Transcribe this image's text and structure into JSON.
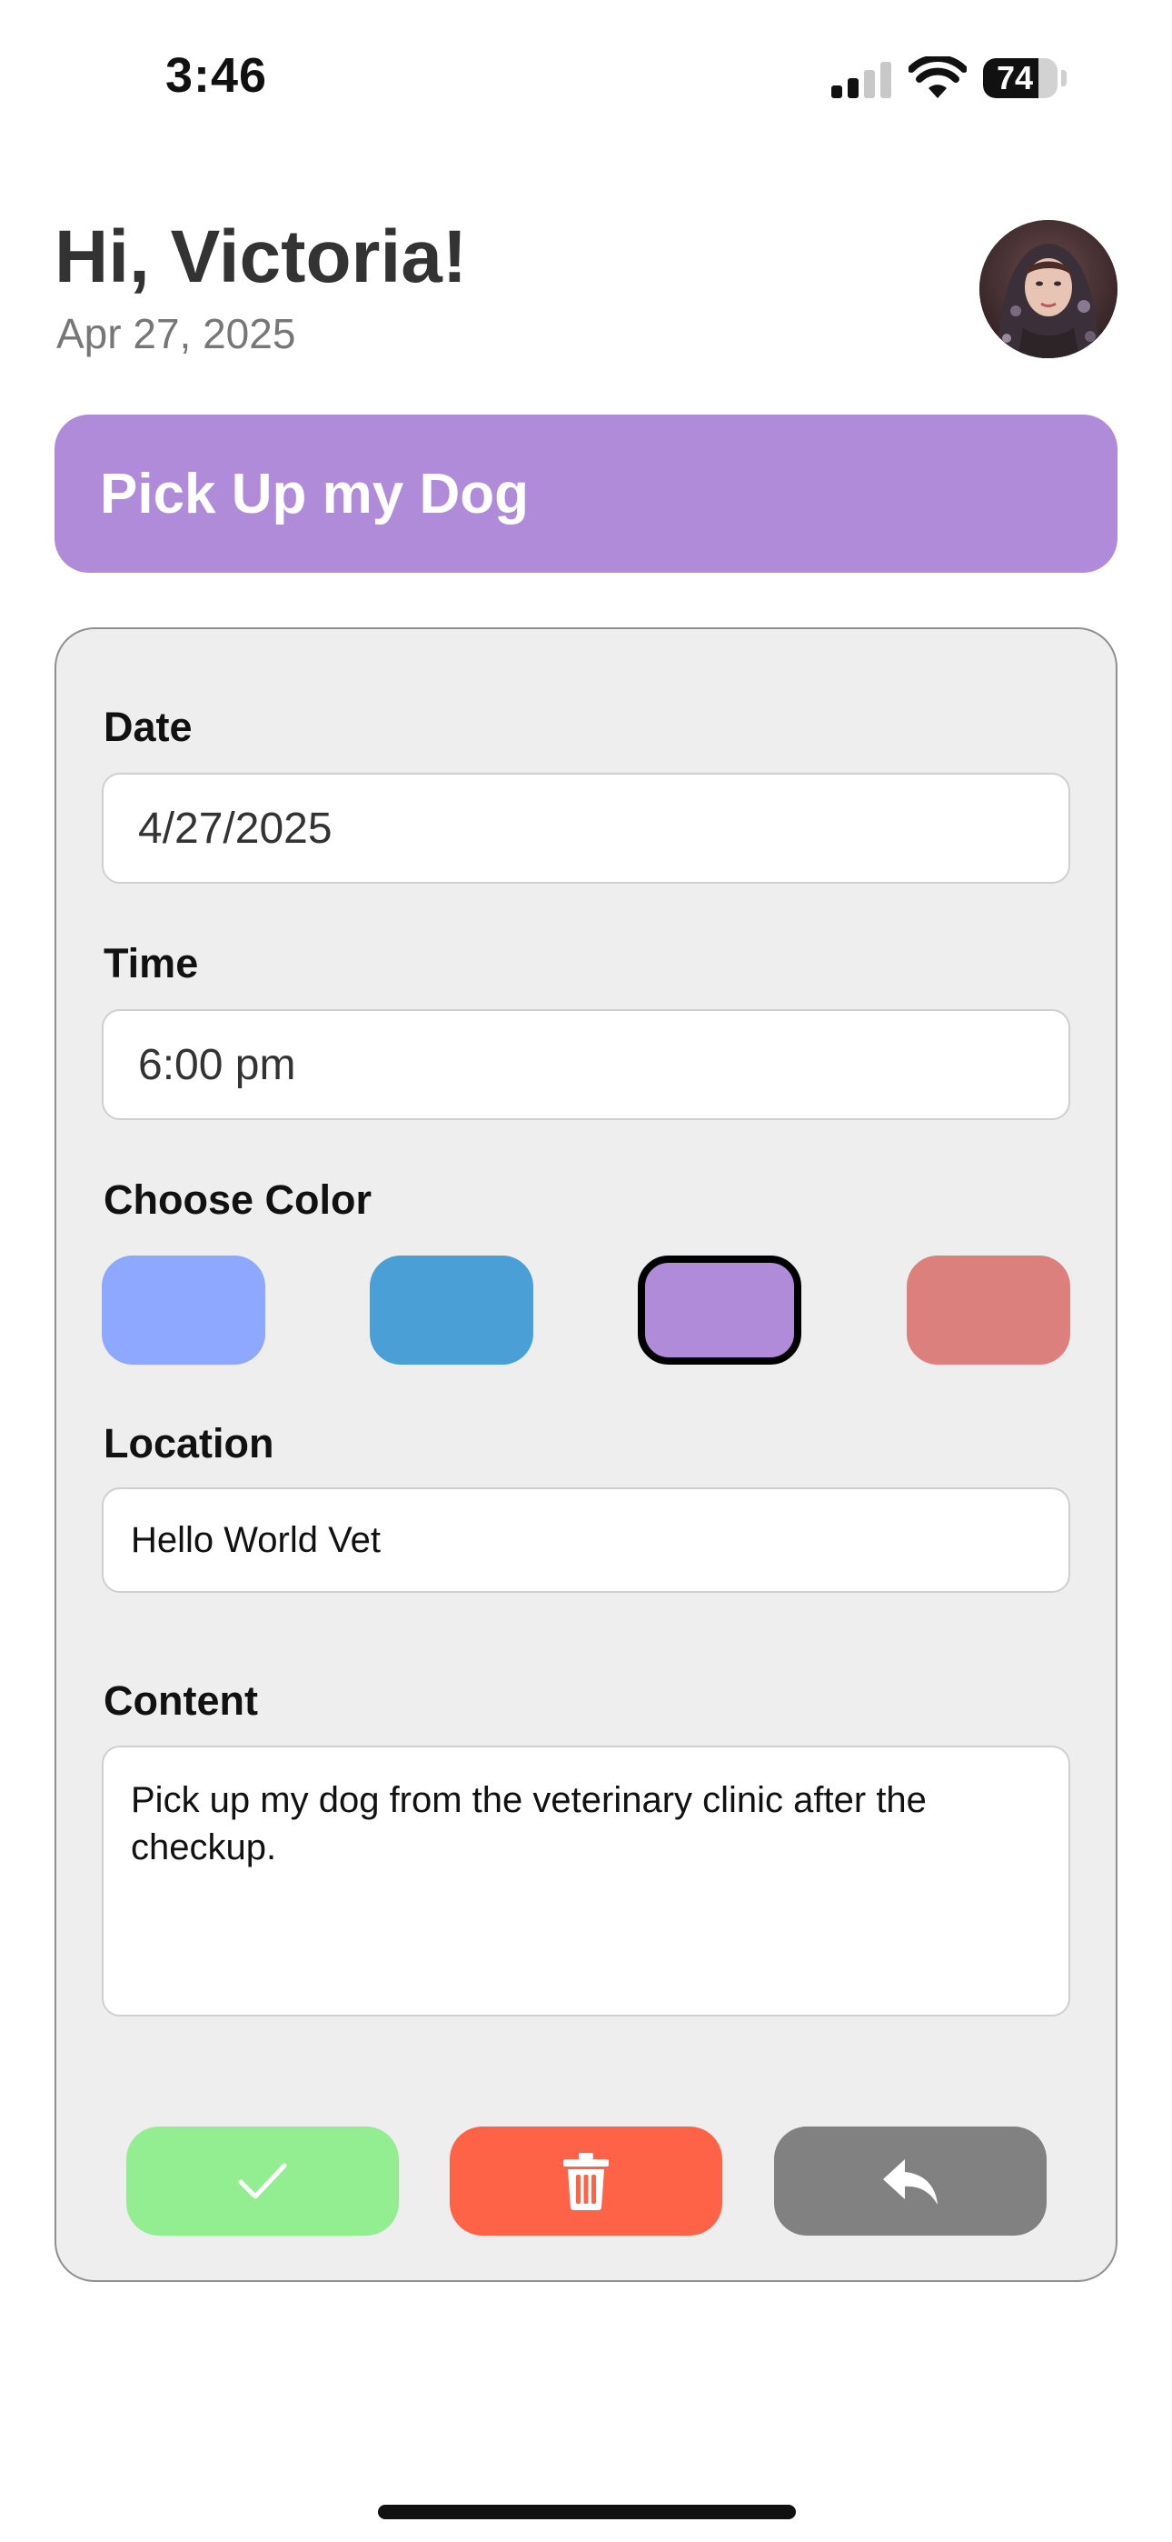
{
  "status_bar": {
    "time": "3:46",
    "battery": "74",
    "battery_level": 0.74
  },
  "header": {
    "greeting": "Hi, Victoria!",
    "date": "Apr 27, 2025"
  },
  "task": {
    "title": "Pick Up my Dog",
    "title_color": "#B08BDA"
  },
  "form": {
    "date_label": "Date",
    "date_value": "4/27/2025",
    "time_label": "Time",
    "time_value": "6:00 pm",
    "color_label": "Choose Color",
    "colors": [
      {
        "hex": "#8EA8FF",
        "selected": false
      },
      {
        "hex": "#4A9FD6",
        "selected": false
      },
      {
        "hex": "#B08BDA",
        "selected": true
      },
      {
        "hex": "#DC807D",
        "selected": false
      }
    ],
    "location_label": "Location",
    "location_value": "Hello World Vet",
    "content_label": "Content",
    "content_value": "Pick up my dog from the veterinary clinic after the checkup."
  },
  "actions": {
    "confirm": {
      "icon": "check-icon",
      "color": "#93EE91"
    },
    "delete": {
      "icon": "trash-icon",
      "color": "#FF6347"
    },
    "back": {
      "icon": "reply-arrow-icon",
      "color": "#818181"
    }
  }
}
